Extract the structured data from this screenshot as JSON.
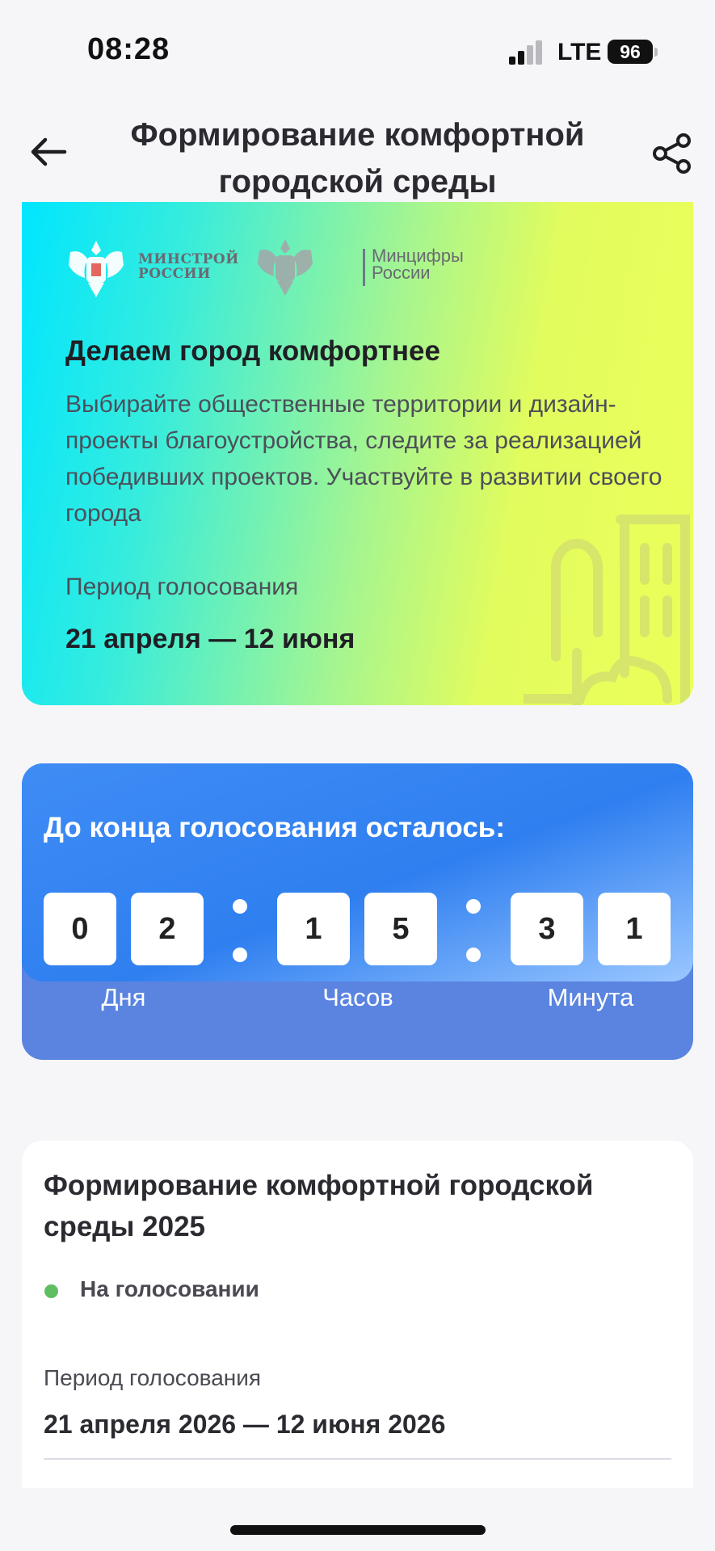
{
  "status_bar": {
    "time": "08:28",
    "network": "LTE",
    "battery": "96"
  },
  "header": {
    "title": "Формирование комфортной городской среды"
  },
  "hero": {
    "logo1": "МИНСТРОЙ РОССИИ",
    "logo2": "Минцифры России",
    "title": "Делаем город комфортнее",
    "description": "Выбирайте общественные территории и дизайн-проекты благоустройства, следите за реализацией победивших проектов. Участвуйте в развитии своего города",
    "period_label": "Период голосования",
    "period": "21 апреля — 12 июня",
    "colors": {
      "gradient_start": "#00e6ff",
      "gradient_end": "#ecff5a"
    }
  },
  "countdown": {
    "title": "До конца голосования осталось:",
    "digits": [
      "0",
      "2",
      "1",
      "5",
      "3",
      "1"
    ],
    "units": [
      "Дня",
      "Часов",
      "Минута"
    ],
    "colors": {
      "card": "#2f7ff0",
      "footer": "#5a84e0"
    }
  },
  "campaign": {
    "title": "Формирование комфортной городской среды 2025",
    "status": "На голосовании",
    "status_color": "#5fbe62",
    "period_label": "Период голосования",
    "period": "21 апреля 2026 — 12 июня 2026"
  },
  "icons": [
    "back-arrow-icon",
    "share-icon",
    "signal-icon",
    "battery-icon",
    "emblem-icon"
  ]
}
